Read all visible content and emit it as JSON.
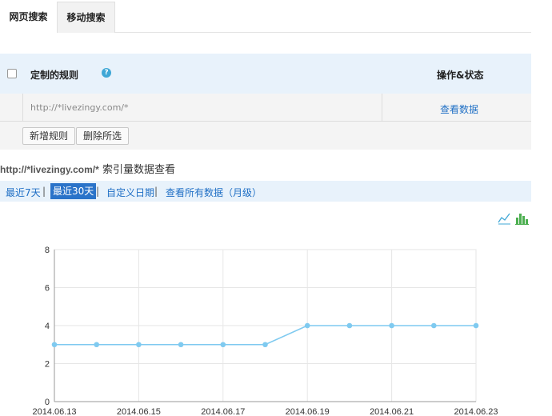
{
  "tabs": [
    {
      "label": "网页搜索",
      "active": true
    },
    {
      "label": "移动搜索",
      "active": false
    }
  ],
  "rules": {
    "header_title": "定制的规则",
    "help_icon": "?",
    "status_header": "操作&状态",
    "rows": [
      {
        "url": "http://*livezingy.com/*",
        "action": "查看数据"
      }
    ],
    "add_button": "新增规则",
    "delete_button": "删除所选"
  },
  "section": {
    "domain": "http://*livezingy.com/*",
    "title": "索引量数据查看"
  },
  "ranges": {
    "items": [
      {
        "label": "最近7天",
        "active": false
      },
      {
        "label": "最近30天",
        "active": true
      },
      {
        "label": "自定义日期",
        "active": false
      },
      {
        "label": "查看所有数据（月级）",
        "active": false
      }
    ],
    "separator": "|"
  },
  "colors": {
    "accent": "#2a73c9",
    "link": "#1f6fc5",
    "line": "#7fcaf0",
    "panel": "#e8f2fb"
  },
  "chart_data": {
    "type": "line",
    "x": [
      "2014.06.13",
      "2014.06.14",
      "2014.06.15",
      "2014.06.16",
      "2014.06.17",
      "2014.06.18",
      "2014.06.19",
      "2014.06.20",
      "2014.06.21",
      "2014.06.22",
      "2014.06.23"
    ],
    "x_tick_labels": [
      "2014.06.13",
      "2014.06.15",
      "2014.06.17",
      "2014.06.19",
      "2014.06.21",
      "2014.06.23"
    ],
    "series": [
      {
        "values": [
          3,
          3,
          3,
          3,
          3,
          3,
          4,
          4,
          4,
          4,
          4
        ]
      }
    ],
    "y_ticks": [
      0,
      2,
      4,
      6,
      8
    ],
    "ylim": [
      0,
      8
    ],
    "grid": true
  }
}
